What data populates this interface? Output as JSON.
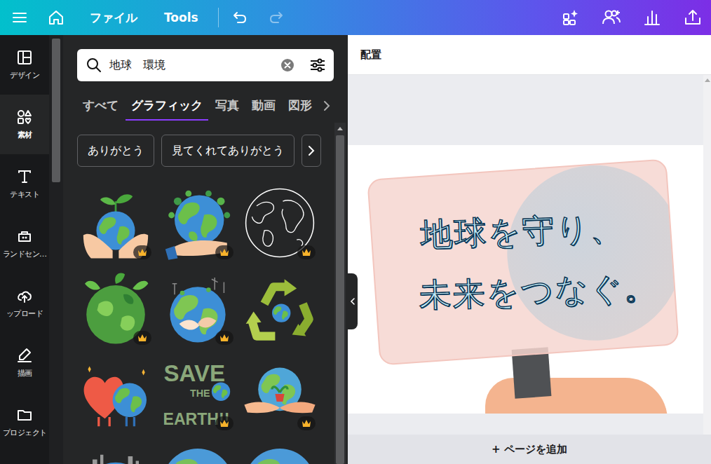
{
  "topbar": {
    "items": [
      "ファイル",
      "Tools"
    ],
    "undo": {
      "disabled": false
    },
    "redo": {
      "disabled": true
    }
  },
  "sidebar": {
    "items": [
      {
        "label": "デザイン",
        "selected": false
      },
      {
        "label": "素材",
        "selected": true
      },
      {
        "label": "テキスト",
        "selected": false
      },
      {
        "label": "ランドセン…",
        "selected": false
      },
      {
        "label": "ップロード",
        "selected": false
      },
      {
        "label": "描画",
        "selected": false
      },
      {
        "label": "プロジェクト",
        "selected": false
      }
    ]
  },
  "search": {
    "value": "地球　環境"
  },
  "tabs": [
    {
      "label": "すべて",
      "selected": false
    },
    {
      "label": "グラフィック",
      "selected": true
    },
    {
      "label": "写真",
      "selected": false
    },
    {
      "label": "動画",
      "selected": false
    },
    {
      "label": "図形",
      "selected": false
    }
  ],
  "chips": [
    "ありがとう",
    "見てくれてありがとう"
  ],
  "graphics": [
    {
      "kind": "hands",
      "premium": true
    },
    {
      "kind": "hand-eco",
      "premium": true
    },
    {
      "kind": "outline",
      "premium": true
    },
    {
      "kind": "leafy",
      "premium": true
    },
    {
      "kind": "hug",
      "premium": true
    },
    {
      "kind": "recycle",
      "premium": false
    },
    {
      "kind": "heart",
      "premium": false
    },
    {
      "kind": "slogan",
      "premium": true,
      "lines": [
        "SAVE",
        "THE",
        "EARTH!!"
      ]
    },
    {
      "kind": "cupped",
      "premium": true
    },
    {
      "kind": "city",
      "premium": false
    },
    {
      "kind": "plain",
      "premium": false
    },
    {
      "kind": "plain",
      "premium": false
    }
  ],
  "editor": {
    "toolbar": "配置",
    "design_lines": [
      "地球を守り、",
      "未来をつなぐ。"
    ],
    "add_page": "+ ページを追加"
  }
}
